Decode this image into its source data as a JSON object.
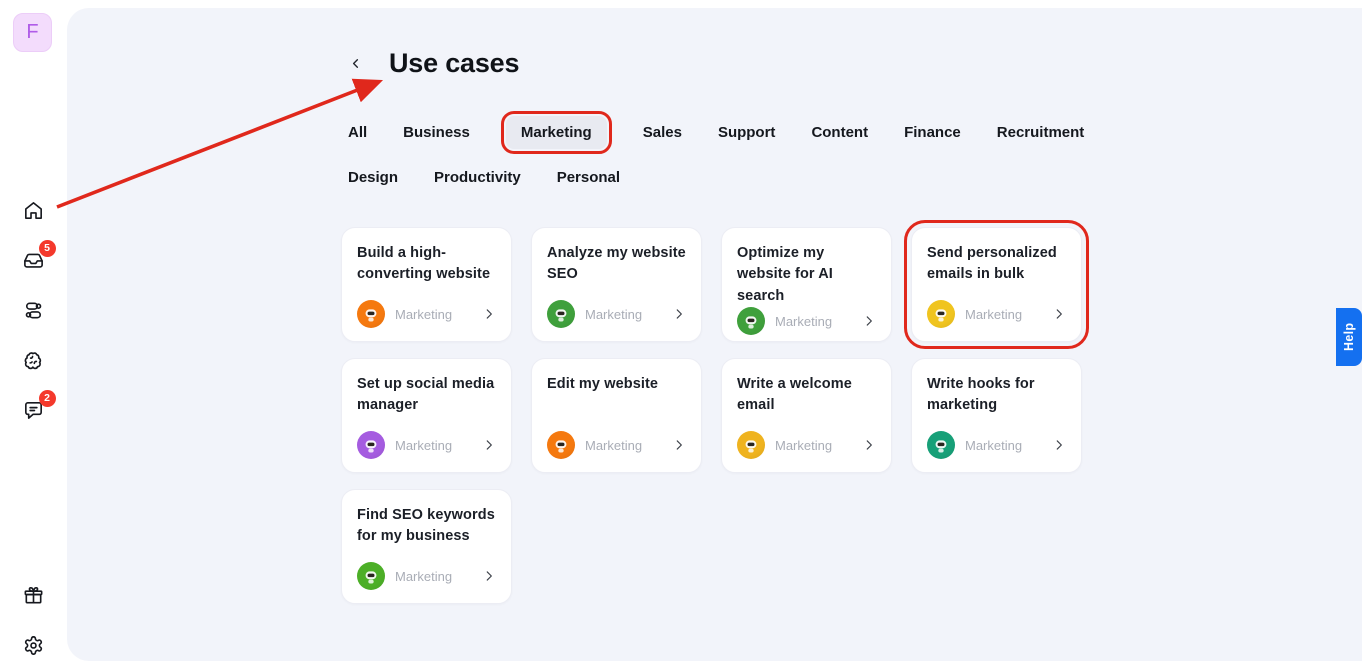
{
  "sidebar": {
    "avatar_letter": "F",
    "badges": {
      "inbox": "5",
      "chat": "2"
    },
    "icons": [
      "home",
      "inbox",
      "toggles",
      "brain",
      "chat",
      "gift",
      "settings"
    ]
  },
  "header": {
    "title": "Use cases"
  },
  "tabs": {
    "rows": [
      [
        {
          "label": "All"
        },
        {
          "label": "Business"
        },
        {
          "label": "Marketing",
          "selected": true,
          "annotated": true
        },
        {
          "label": "Sales"
        },
        {
          "label": "Support"
        },
        {
          "label": "Content"
        },
        {
          "label": "Finance"
        },
        {
          "label": "Recruitment"
        }
      ],
      [
        {
          "label": "Design"
        },
        {
          "label": "Productivity"
        },
        {
          "label": "Personal"
        }
      ]
    ]
  },
  "cards": [
    {
      "title": "Build a high-converting website",
      "category": "Marketing",
      "avatar_color": "#f5790f"
    },
    {
      "title": "Analyze my website SEO",
      "category": "Marketing",
      "avatar_color": "#3fa03c"
    },
    {
      "title": "Optimize my website for AI search",
      "category": "Marketing",
      "avatar_color": "#3fa03c"
    },
    {
      "title": "Send personalized emails in bulk",
      "category": "Marketing",
      "avatar_color": "#f0c41f",
      "annotated": true
    },
    {
      "title": "Set up social media manager",
      "category": "Marketing",
      "avatar_color": "#a55ce0"
    },
    {
      "title": "Edit my website",
      "category": "Marketing",
      "avatar_color": "#f5790f"
    },
    {
      "title": "Write a welcome email",
      "category": "Marketing",
      "avatar_color": "#efb31f"
    },
    {
      "title": "Write hooks for marketing",
      "category": "Marketing",
      "avatar_color": "#17a078"
    },
    {
      "title": "Find SEO keywords for my business",
      "category": "Marketing",
      "avatar_color": "#4caf27"
    }
  ],
  "help_button": {
    "label": "Help",
    "color": "#1470f0"
  },
  "annotations": {
    "color": "#e0281c",
    "badge_color": "#f4392c"
  }
}
